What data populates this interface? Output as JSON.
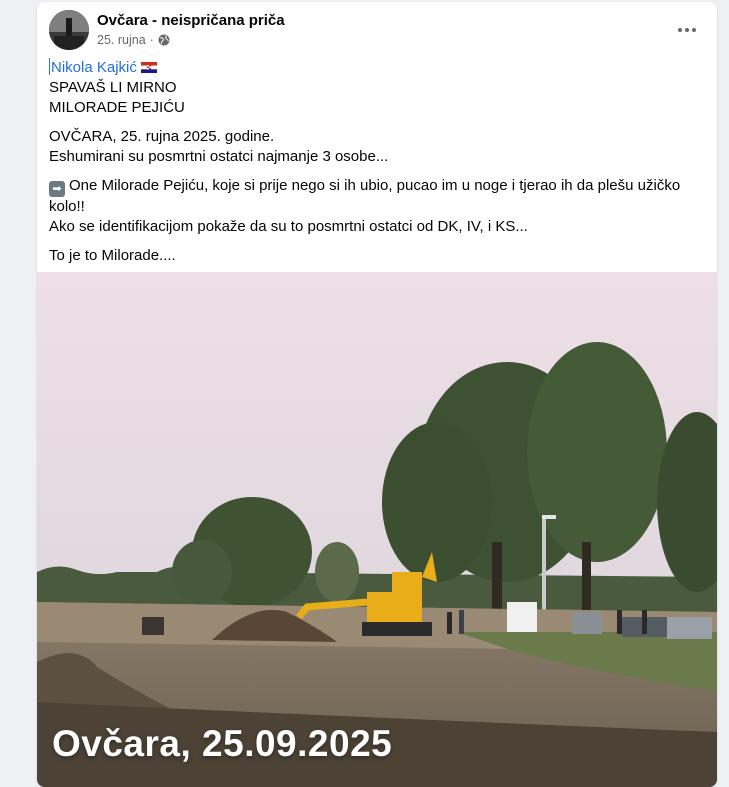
{
  "post": {
    "page_name": "Ovčara - neispričana priča",
    "date": "25. rujna",
    "separator": "·",
    "author_tag": "Nikola Kajkić",
    "lines": {
      "l1": "SPAVAŠ LI MIRNO",
      "l2": "MILORADE PEJIĆU",
      "l3": "OVČARA, 25. rujna 2025. godine.",
      "l4": "Eshumirani su posmrtni ostatci najmanje 3 osobe...",
      "l5": "One Milorade Pejiću, koje si prije nego si ih ubio, pucao im u noge i tjerao ih da plešu užičko kolo!!",
      "l6": "Ako se identifikacijom pokaže da su to posmrtni ostatci od DK, IV, i KS...",
      "l7": "To je to Milorade...."
    },
    "image_caption": "Ovčara, 25.09.2025"
  },
  "icons": {
    "avatar": "page-avatar-monument",
    "privacy": "globe-icon",
    "menu": "more-options-icon",
    "flag": "croatia-flag-icon",
    "arrow": "right-arrow-emoji"
  },
  "colors": {
    "link": "#216fdb",
    "meta": "#65676b",
    "background": "#eef0f3"
  }
}
